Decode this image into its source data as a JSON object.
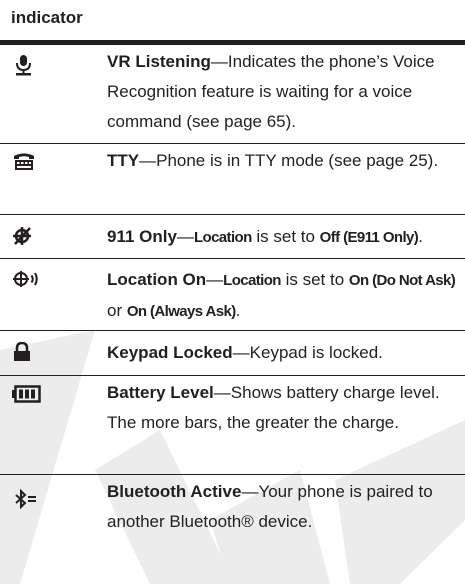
{
  "table": {
    "header": "indicator",
    "rows": [
      {
        "icon": "microphone-icon",
        "title": "VR Listening",
        "desc": "Indicates the phone’s Voice Recognition feature is waiting for a voice command (see page 65)."
      },
      {
        "icon": "tty-icon",
        "title": "TTY",
        "desc": "Phone is in TTY mode (see page 25)."
      },
      {
        "icon": "location-off-icon",
        "title": "911 Only",
        "d1": "Location",
        "d2": " is set to ",
        "d3": "Off (E911 Only)",
        "d4": "."
      },
      {
        "icon": "location-on-icon",
        "title": "Location On",
        "d1": "Location",
        "d2": " is set to ",
        "d3": "On (Do Not Ask)",
        "d4": " or ",
        "d5": "On (Always Ask)",
        "d6": "."
      },
      {
        "icon": "lock-icon",
        "title": "Keypad Locked",
        "desc": "Keypad is locked."
      },
      {
        "icon": "battery-icon",
        "title": "Battery Level",
        "desc": "Shows battery charge level. The more bars, the greater the charge."
      },
      {
        "icon": "bluetooth-icon",
        "title": "Bluetooth Active",
        "desc": "Your phone is paired to another Bluetooth® device."
      }
    ],
    "dash": "—"
  },
  "colors": {
    "text": "#231f20",
    "watermark": "#e9e9e9"
  }
}
